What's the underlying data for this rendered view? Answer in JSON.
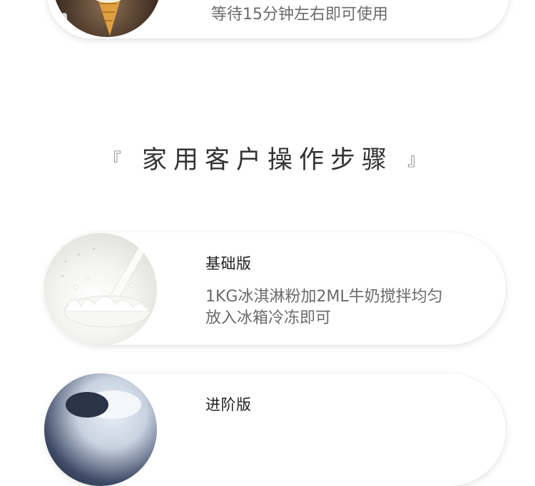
{
  "top_card": {
    "desc": "等待15分钟左右即可使用",
    "image": "ice-cream-cone-photo"
  },
  "section": {
    "open_bracket": "『",
    "heading": "家用客户操作步骤",
    "close_bracket": "』"
  },
  "steps": [
    {
      "title": "基础版",
      "desc_line1": "1KG冰淇淋粉加2ML牛奶搅拌均匀",
      "desc_line2": "放入冰箱冷冻即可",
      "image": "milk-splash-photo"
    },
    {
      "title": "进阶版",
      "image": "ice-cream-bowl-photo"
    }
  ]
}
